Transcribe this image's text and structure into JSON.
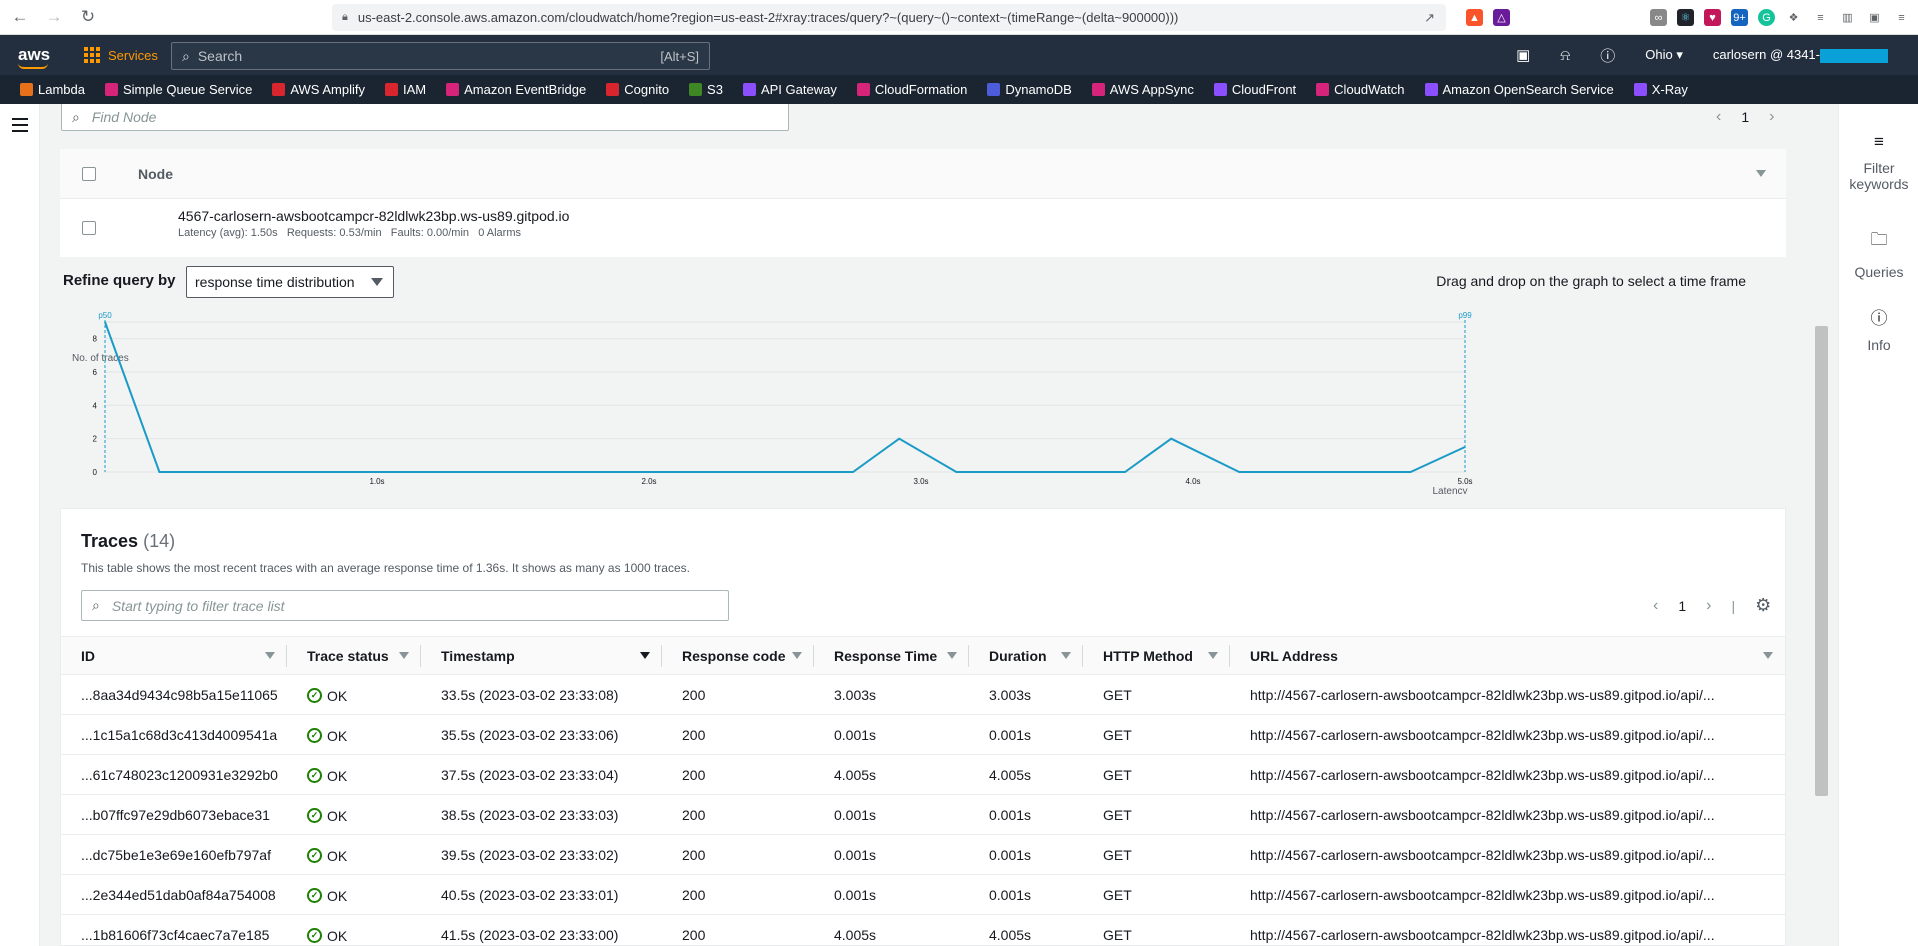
{
  "browser": {
    "url": "us-east-2.console.aws.amazon.com/cloudwatch/home?region=us-east-2#xray:traces/query?~(query~()~context~(timeRange~(delta~900000)))"
  },
  "aws_nav": {
    "logo": "aws",
    "services_label": "Services",
    "search_placeholder": "Search",
    "search_shortcut": "[Alt+S]",
    "region": "Ohio",
    "account": "carlosern @ 4341-"
  },
  "favorites": [
    {
      "label": "Lambda",
      "color": "#e7701b"
    },
    {
      "label": "Simple Queue Service",
      "color": "#d6247b"
    },
    {
      "label": "AWS Amplify",
      "color": "#d9262e"
    },
    {
      "label": "IAM",
      "color": "#d9262e"
    },
    {
      "label": "Amazon EventBridge",
      "color": "#d6247b"
    },
    {
      "label": "Cognito",
      "color": "#d9262e"
    },
    {
      "label": "S3",
      "color": "#3f8624"
    },
    {
      "label": "API Gateway",
      "color": "#8c4fff"
    },
    {
      "label": "CloudFormation",
      "color": "#d6247b"
    },
    {
      "label": "DynamoDB",
      "color": "#4d5cdb"
    },
    {
      "label": "AWS AppSync",
      "color": "#d6247b"
    },
    {
      "label": "CloudFront",
      "color": "#8c4fff"
    },
    {
      "label": "CloudWatch",
      "color": "#d6247b"
    },
    {
      "label": "Amazon OpenSearch Service",
      "color": "#8c4fff"
    },
    {
      "label": "X-Ray",
      "color": "#8c4fff"
    }
  ],
  "right_panel": {
    "filter_keywords": "Filter keywords",
    "queries": "Queries",
    "info": "Info"
  },
  "nodes": {
    "find_placeholder": "Find Node",
    "page": "1",
    "column_header": "Node",
    "items": [
      {
        "name": "4567-carlosern-awsbootcampcr-82ldlwk23bp.ws-us89.gitpod.io",
        "stats": "Latency (avg): 1.50s   Requests: 0.53/min   Faults: 0.00/min   0 Alarms"
      }
    ]
  },
  "refine": {
    "label": "Refine query by",
    "selected": "response time distribution",
    "hint": "Drag and drop on the graph to select a time frame"
  },
  "chart_data": {
    "type": "line",
    "ylabel": "No. of traces",
    "xlabel": "Latency",
    "y_ticks": [
      0,
      2,
      4,
      6,
      8
    ],
    "x_ticks": [
      "1.0s",
      "2.0s",
      "3.0s",
      "4.0s",
      "5.0s"
    ],
    "xlim": [
      0.0,
      5.0
    ],
    "ylim": [
      0,
      9
    ],
    "markers": [
      {
        "label": "p50",
        "x": 0.0
      },
      {
        "label": "p99",
        "x": 5.0
      }
    ],
    "series": [
      {
        "x": [
          0.0,
          0.2,
          2.75,
          2.92,
          3.13,
          3.75,
          3.92,
          4.17,
          4.8,
          5.0
        ],
        "y": [
          9,
          0,
          0,
          2,
          0,
          0,
          2,
          0,
          0,
          1.5
        ]
      }
    ],
    "color": "#1a9bc7"
  },
  "traces": {
    "title": "Traces",
    "count": "(14)",
    "description": "This table shows the most recent traces with an average response time of 1.36s. It shows as many as 1000 traces.",
    "filter_placeholder": "Start typing to filter trace list",
    "page": "1",
    "columns": [
      "ID",
      "Trace status",
      "Timestamp",
      "Response code",
      "Response Time",
      "Duration",
      "HTTP Method",
      "URL Address"
    ],
    "rows": [
      {
        "id": "...8aa34d9434c98b5a15e11065",
        "status": "OK",
        "timestamp": "33.5s (2023-03-02 23:33:08)",
        "code": "200",
        "response_time": "3.003s",
        "duration": "3.003s",
        "method": "GET",
        "url": "http://4567-carlosern-awsbootcampcr-82ldlwk23bp.ws-us89.gitpod.io/api/..."
      },
      {
        "id": "...1c15a1c68d3c413d4009541a",
        "status": "OK",
        "timestamp": "35.5s (2023-03-02 23:33:06)",
        "code": "200",
        "response_time": "0.001s",
        "duration": "0.001s",
        "method": "GET",
        "url": "http://4567-carlosern-awsbootcampcr-82ldlwk23bp.ws-us89.gitpod.io/api/..."
      },
      {
        "id": "...61c748023c1200931e3292b0",
        "status": "OK",
        "timestamp": "37.5s (2023-03-02 23:33:04)",
        "code": "200",
        "response_time": "4.005s",
        "duration": "4.005s",
        "method": "GET",
        "url": "http://4567-carlosern-awsbootcampcr-82ldlwk23bp.ws-us89.gitpod.io/api/..."
      },
      {
        "id": "...b07ffc97e29db6073ebace31",
        "status": "OK",
        "timestamp": "38.5s (2023-03-02 23:33:03)",
        "code": "200",
        "response_time": "0.001s",
        "duration": "0.001s",
        "method": "GET",
        "url": "http://4567-carlosern-awsbootcampcr-82ldlwk23bp.ws-us89.gitpod.io/api/..."
      },
      {
        "id": "...dc75be1e3e69e160efb797af",
        "status": "OK",
        "timestamp": "39.5s (2023-03-02 23:33:02)",
        "code": "200",
        "response_time": "0.001s",
        "duration": "0.001s",
        "method": "GET",
        "url": "http://4567-carlosern-awsbootcampcr-82ldlwk23bp.ws-us89.gitpod.io/api/..."
      },
      {
        "id": "...2e344ed51dab0af84a754008",
        "status": "OK",
        "timestamp": "40.5s (2023-03-02 23:33:01)",
        "code": "200",
        "response_time": "0.001s",
        "duration": "0.001s",
        "method": "GET",
        "url": "http://4567-carlosern-awsbootcampcr-82ldlwk23bp.ws-us89.gitpod.io/api/..."
      },
      {
        "id": "...1b81606f73cf4caec7a7e185",
        "status": "OK",
        "timestamp": "41.5s (2023-03-02 23:33:00)",
        "code": "200",
        "response_time": "4.005s",
        "duration": "4.005s",
        "method": "GET",
        "url": "http://4567-carlosern-awsbootcampcr-82ldlwk23bp.ws-us89.gitpod.io/api/..."
      }
    ]
  }
}
